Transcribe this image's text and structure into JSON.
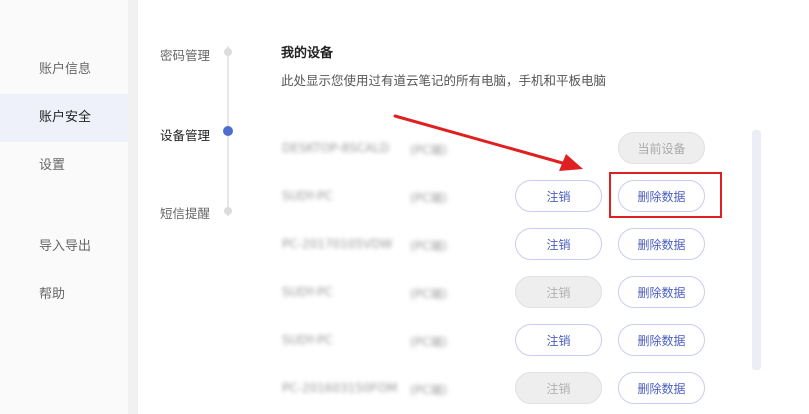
{
  "sidebar": {
    "items": [
      {
        "label": "账户信息"
      },
      {
        "label": "账户安全"
      },
      {
        "label": "设置"
      },
      {
        "label": "导入导出"
      },
      {
        "label": "帮助"
      }
    ]
  },
  "steps": [
    {
      "label": "密码管理"
    },
    {
      "label": "设备管理"
    },
    {
      "label": "短信提醒"
    }
  ],
  "main": {
    "title": "我的设备",
    "subtitle": "此处显示您使用过有道云笔记的所有电脑，手机和平板电脑"
  },
  "devices": [
    {
      "name": "DESKTOP-8SCALD",
      "type": "(PC端)",
      "action": "当前设备"
    },
    {
      "name": "SUDY-PC",
      "type": "(PC端)",
      "logout": "注销",
      "delete": "删除数据"
    },
    {
      "name": "PC-20170105VDW",
      "type": "(PC端)",
      "logout": "注销",
      "delete": "删除数据"
    },
    {
      "name": "SUDY-PC",
      "type": "(PC端)",
      "logout": "注销",
      "delete": "删除数据"
    },
    {
      "name": "SUDY-PC",
      "type": "(PC端)",
      "logout": "注销",
      "delete": "删除数据"
    },
    {
      "name": "PC-201603150FOM",
      "type": "(PC端)",
      "logout": "注销",
      "delete": "删除数据"
    }
  ],
  "colors": {
    "accent": "#4e6ecf",
    "annotation": "#e02020"
  }
}
